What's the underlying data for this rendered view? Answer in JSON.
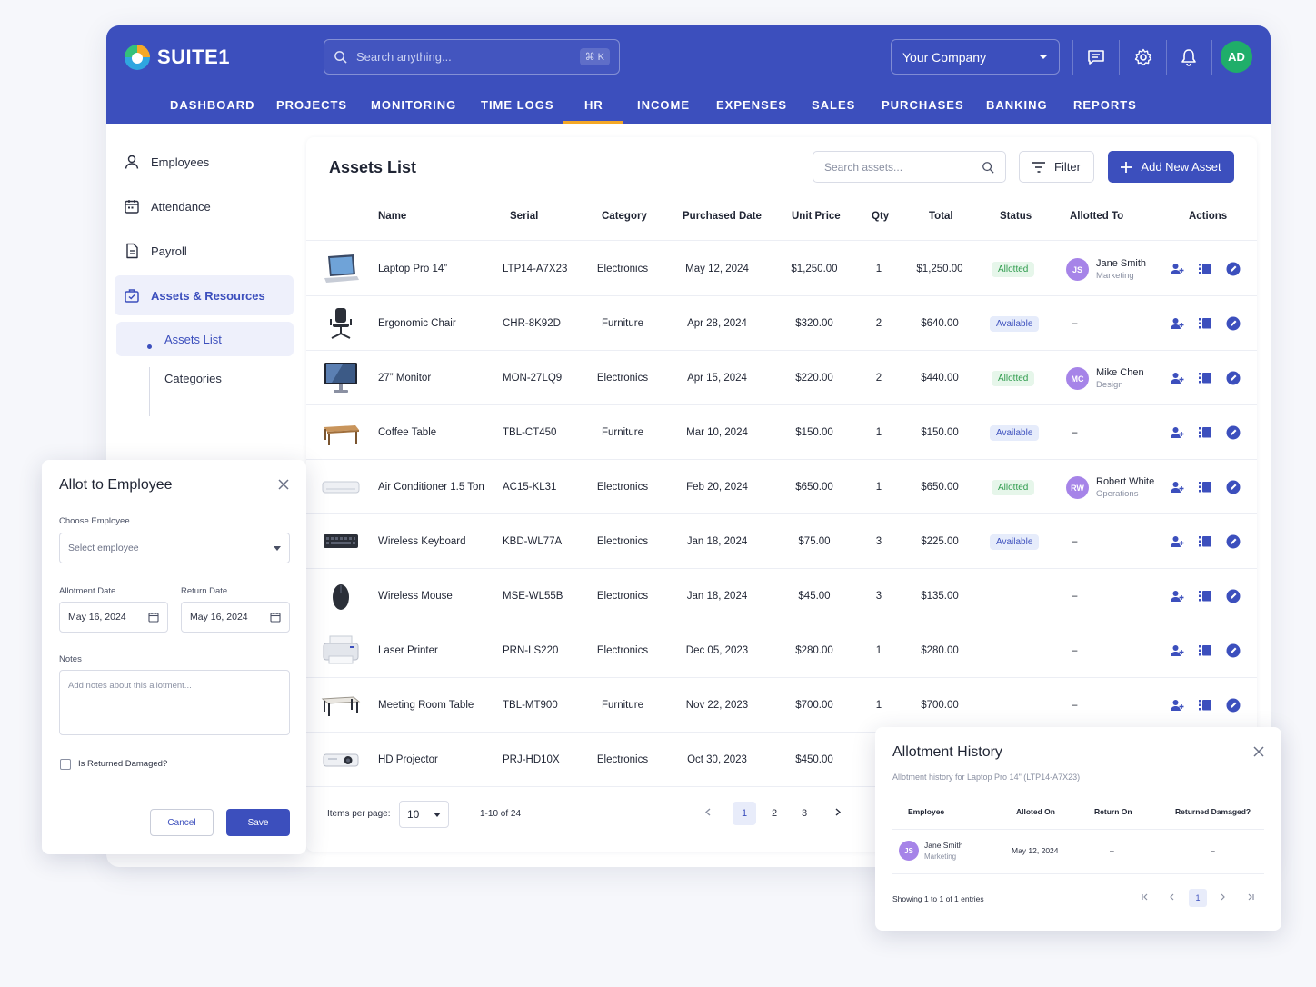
{
  "brand": {
    "name": "SUITE1"
  },
  "search": {
    "placeholder": "Search anything...",
    "shortcut": "⌘ K"
  },
  "company": {
    "selected": "Your Company"
  },
  "user": {
    "initials": "AD"
  },
  "nav": [
    "DASHBOARD",
    "PROJECTS",
    "MONITORING",
    "TIME LOGS",
    "HR",
    "INCOME",
    "EXPENSES",
    "SALES",
    "PURCHASES",
    "BANKING",
    "REPORTS"
  ],
  "nav_active": "HR",
  "sidebar": {
    "items": [
      {
        "label": "Employees",
        "icon": "user-icon"
      },
      {
        "label": "Attendance",
        "icon": "calendar-icon"
      },
      {
        "label": "Payroll",
        "icon": "document-icon"
      },
      {
        "label": "Assets & Resources",
        "icon": "assets-icon"
      }
    ],
    "sub_items": [
      {
        "label": "Assets List"
      },
      {
        "label": "Categories"
      }
    ]
  },
  "assets": {
    "title": "Assets List",
    "search_placeholder": "Search assets...",
    "filter_label": "Filter",
    "add_label": "Add New Asset",
    "columns": [
      "Name",
      "Serial",
      "Category",
      "Purchased Date",
      "Unit Price",
      "Qty",
      "Total",
      "Status",
      "Allotted To",
      "Actions"
    ],
    "rows": [
      {
        "name": "Laptop Pro 14”",
        "serial": "LTP14-A7X23",
        "category": "Electronics",
        "date": "May 12, 2024",
        "price": "$1,250.00",
        "qty": "1",
        "total": "$1,250.00",
        "status": "Allotted",
        "emp_initials": "JS",
        "emp_name": "Jane Smith",
        "emp_dept": "Marketing",
        "thumb": "laptop"
      },
      {
        "name": "Ergonomic Chair",
        "serial": "CHR-8K92D",
        "category": "Furniture",
        "date": "Apr 28, 2024",
        "price": "$320.00",
        "qty": "2",
        "total": "$640.00",
        "status": "Available",
        "emp_initials": "",
        "emp_name": "–",
        "emp_dept": "",
        "thumb": "chair"
      },
      {
        "name": "27” Monitor",
        "serial": "MON-27LQ9",
        "category": "Electronics",
        "date": "Apr 15, 2024",
        "price": "$220.00",
        "qty": "2",
        "total": "$440.00",
        "status": "Allotted",
        "emp_initials": "MC",
        "emp_name": "Mike Chen",
        "emp_dept": "Design",
        "thumb": "monitor"
      },
      {
        "name": "Coffee Table",
        "serial": "TBL-CT450",
        "category": "Furniture",
        "date": "Mar 10, 2024",
        "price": "$150.00",
        "qty": "1",
        "total": "$150.00",
        "status": "Available",
        "emp_initials": "",
        "emp_name": "–",
        "emp_dept": "",
        "thumb": "table"
      },
      {
        "name": "Air Conditioner 1.5 Ton",
        "serial": "AC15-KL31",
        "category": "Electronics",
        "date": "Feb 20, 2024",
        "price": "$650.00",
        "qty": "1",
        "total": "$650.00",
        "status": "Allotted",
        "emp_initials": "RW",
        "emp_name": "Robert White",
        "emp_dept": "Operations",
        "thumb": "ac"
      },
      {
        "name": "Wireless Keyboard",
        "serial": "KBD-WL77A",
        "category": "Electronics",
        "date": "Jan 18, 2024",
        "price": "$75.00",
        "qty": "3",
        "total": "$225.00",
        "status": "Available",
        "emp_initials": "",
        "emp_name": "–",
        "emp_dept": "",
        "thumb": "keyboard"
      },
      {
        "name": "Wireless Mouse",
        "serial": "MSE-WL55B",
        "category": "Electronics",
        "date": "Jan 18, 2024",
        "price": "$45.00",
        "qty": "3",
        "total": "$135.00",
        "status": "",
        "emp_initials": "",
        "emp_name": "–",
        "emp_dept": "",
        "thumb": "mouse"
      },
      {
        "name": "Laser Printer",
        "serial": "PRN-LS220",
        "category": "Electronics",
        "date": "Dec 05, 2023",
        "price": "$280.00",
        "qty": "1",
        "total": "$280.00",
        "status": "",
        "emp_initials": "",
        "emp_name": "–",
        "emp_dept": "",
        "thumb": "printer"
      },
      {
        "name": "Meeting Room Table",
        "serial": "TBL-MT900",
        "category": "Furniture",
        "date": "Nov 22, 2023",
        "price": "$700.00",
        "qty": "1",
        "total": "$700.00",
        "status": "",
        "emp_initials": "",
        "emp_name": "–",
        "emp_dept": "",
        "thumb": "meeting-table"
      },
      {
        "name": "HD Projector",
        "serial": "PRJ-HD10X",
        "category": "Electronics",
        "date": "Oct 30, 2023",
        "price": "$450.00",
        "qty": "",
        "total": "",
        "status": "",
        "emp_initials": "",
        "emp_name": "",
        "emp_dept": "",
        "thumb": "projector"
      }
    ],
    "pagination": {
      "items_per_page_label": "Items per page:",
      "items_per_page": "10",
      "range": "1-10 of 24",
      "pages": [
        "1",
        "2",
        "3"
      ],
      "current": "1"
    }
  },
  "allot_modal": {
    "title": "Allot to Employee",
    "employee_label": "Choose Employee",
    "employee_placeholder": "Select employee",
    "allotment_date_label": "Allotment Date",
    "allotment_date": "May 16, 2024",
    "return_date_label": "Return Date",
    "return_date": "May 16, 2024",
    "notes_label": "Notes",
    "notes_placeholder": "Add notes about this allotment...",
    "damaged_label": "Is Returned Damaged?",
    "cancel_label": "Cancel",
    "save_label": "Save"
  },
  "history": {
    "title": "Allotment History",
    "subtitle": "Allotment history for Laptop Pro 14\" (LTP14-A7X23)",
    "columns": [
      "Employee",
      "Alloted On",
      "Return On",
      "Returned Damaged?"
    ],
    "rows": [
      {
        "initials": "JS",
        "name": "Jane Smith",
        "dept": "Marketing",
        "alloted_on": "May 12, 2024",
        "return_on": "–",
        "damaged": "–"
      }
    ],
    "footer": "Showing 1 to 1 of 1 entries",
    "current_page": "1"
  },
  "colors": {
    "primary": "#3c4fbd",
    "accent": "#f4a826",
    "success": "#2c9a4b",
    "avatar": "#a684e8",
    "user_avatar": "#1fae6a"
  }
}
